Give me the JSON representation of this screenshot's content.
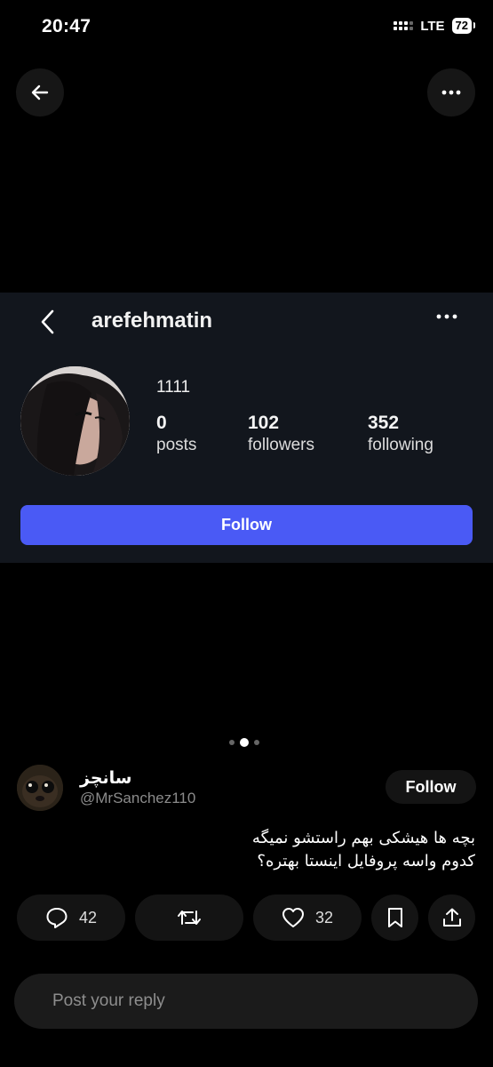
{
  "status_bar": {
    "time": "20:47",
    "network": "LTE",
    "battery": "72"
  },
  "instagram_card": {
    "username": "arefehmatin",
    "full_name": "1111",
    "stats": [
      {
        "number": "0",
        "label": "posts"
      },
      {
        "number": "102",
        "label": "followers"
      },
      {
        "number": "352",
        "label": "following"
      }
    ],
    "follow_label": "Follow"
  },
  "carousel": {
    "count": 3,
    "active": 2
  },
  "post": {
    "author_name": "سانچز",
    "author_handle": "@MrSanchez110",
    "follow_label": "Follow",
    "text_line1": "بچه ها هیشکی بهم راستشو نمیگه",
    "text_line2": "کدوم واسه پروفایل اینستا بهتره؟"
  },
  "actions": {
    "replies": "42",
    "likes": "32"
  },
  "reply_box": {
    "placeholder": "Post your reply"
  },
  "colors": {
    "background": "#000000",
    "card": "#12161d",
    "accent": "#4a5af5",
    "pill": "#141414"
  },
  "icons": [
    "back-arrow-icon",
    "more-icon",
    "chevron-left-icon",
    "reply-icon",
    "retweet-icon",
    "heart-icon",
    "bookmark-icon",
    "share-icon"
  ]
}
